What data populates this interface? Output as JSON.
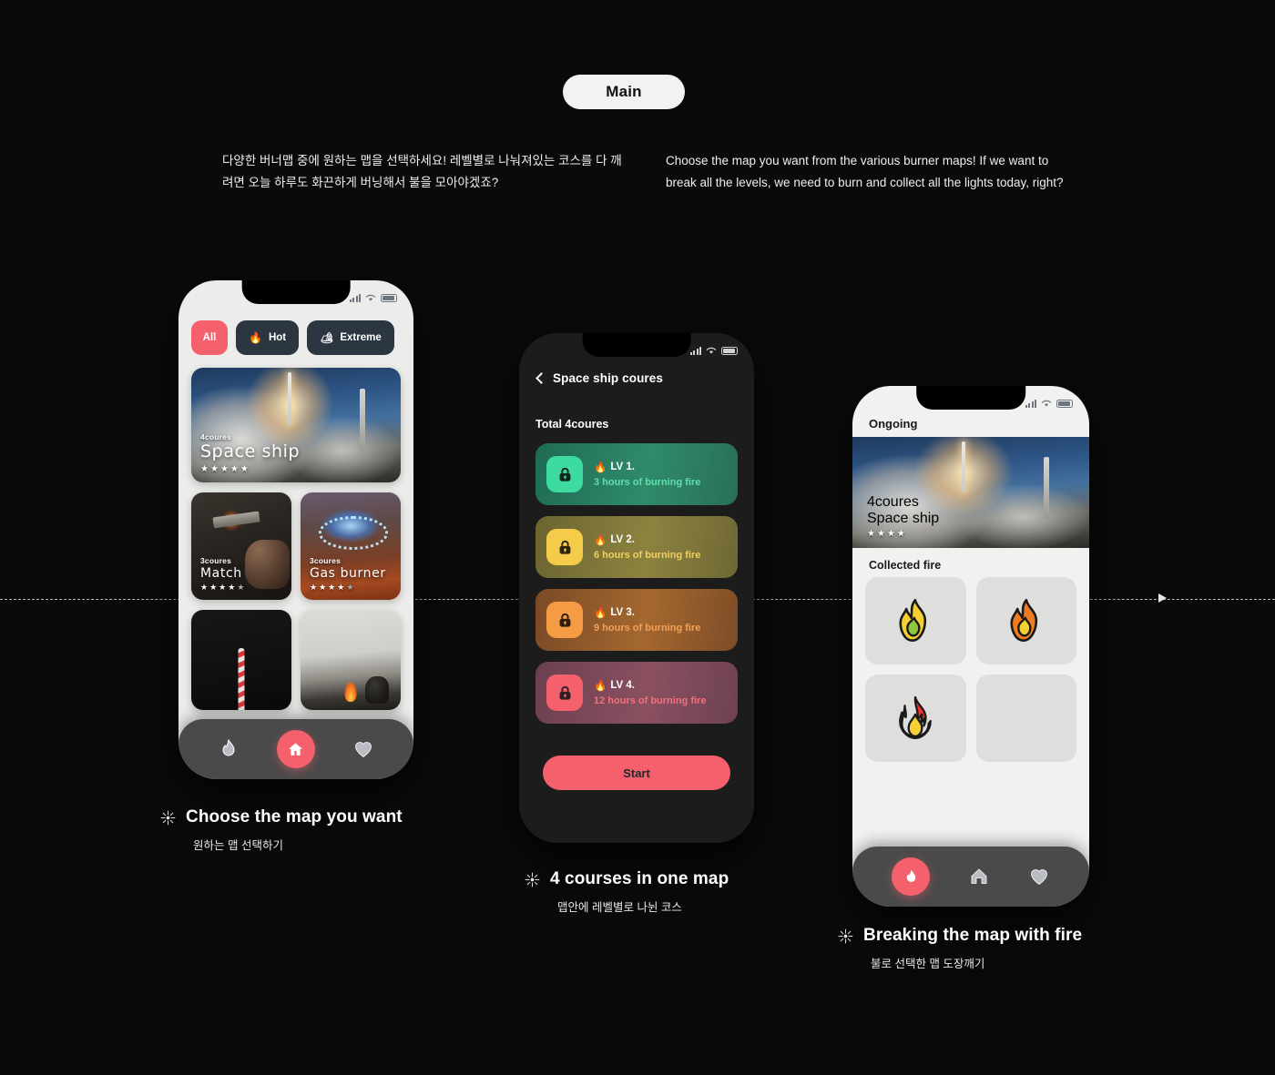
{
  "header": {
    "pill_label": "Main"
  },
  "description": {
    "korean": "다양한 버너맵 중에 원하는 맵을 선택하세요! 레벨별로 나눠져있는 코스를 다 깨려면 오늘 하루도 화끈하게 버닝해서 불을 모아야겠죠?",
    "english": "Choose the map you want from the various burner maps! If we want to break all the levels, we need to burn and collect all the lights today, right?"
  },
  "phone1": {
    "filters": [
      {
        "label": "All",
        "emoji": "",
        "active": true
      },
      {
        "label": "Hot",
        "emoji": "🔥",
        "active": false
      },
      {
        "label": "Extreme",
        "emoji": "🏕",
        "active": false
      }
    ],
    "cards": [
      {
        "coures": "4coures",
        "title": "Space ship",
        "stars": 5,
        "stars_total": 5
      },
      {
        "coures": "3coures",
        "title": "Match",
        "stars": 4,
        "stars_total": 5
      },
      {
        "coures": "3coures",
        "title": "Gas burner",
        "stars": 4,
        "stars_total": 5
      }
    ],
    "tabbar": [
      {
        "icon": "flame-icon",
        "active": false
      },
      {
        "icon": "home-icon",
        "active": true
      },
      {
        "icon": "heart-icon",
        "active": false
      }
    ]
  },
  "phone2": {
    "nav_title": "Space ship coures",
    "total_label": "Total 4coures",
    "levels": [
      {
        "name": "LV 1.",
        "desc": "3 hours of burning fire",
        "lock_color": "#3ddba0",
        "card_from": "#1f6b54",
        "card_to": "#2f8a6a",
        "text_color": "#5fe0ae"
      },
      {
        "name": "LV 2.",
        "desc": "6 hours of burning fire",
        "lock_color": "#f5cc4a",
        "card_from": "#6b6430",
        "card_to": "#8c8340",
        "text_color": "#f3cf5e"
      },
      {
        "name": "LV 3.",
        "desc": "9 hours of burning fire",
        "lock_color": "#f59b44",
        "card_from": "#7a4a26",
        "card_to": "#a4682f",
        "text_color": "#f5a055"
      },
      {
        "name": "LV 4.",
        "desc": "12 hours of burning fire",
        "lock_color": "#f4606c",
        "card_from": "#6b4050",
        "card_to": "#8a5060",
        "text_color": "#f4707c"
      }
    ],
    "start_label": "Start"
  },
  "phone3": {
    "header": "Ongoing",
    "hero": {
      "coures": "4coures",
      "title": "Space ship",
      "stars": 4,
      "stars_total": 4
    },
    "collected_label": "Collected fire",
    "fire_slots": [
      {
        "filled": true,
        "name": "flame-yellow-green-icon",
        "outer": "#f5d033",
        "inner": "#8fc63d"
      },
      {
        "filled": true,
        "name": "flame-orange-icon",
        "outer": "#f07c22",
        "inner": "#f5d033"
      },
      {
        "filled": true,
        "name": "flame-red-big-icon",
        "outer": "#ed3124",
        "inner": "#f5d033"
      },
      {
        "filled": false,
        "name": "flame-empty-slot",
        "outer": "",
        "inner": ""
      }
    ],
    "tabbar": [
      {
        "icon": "flame-icon",
        "active": true
      },
      {
        "icon": "home-icon",
        "active": false
      },
      {
        "icon": "heart-icon",
        "active": false
      }
    ]
  },
  "captions": [
    {
      "title": "Choose the map you want",
      "sub": "원하는 맵 선택하기"
    },
    {
      "title": "4 courses in one map",
      "sub": "맵안에 레벨별로 나뉜 코스"
    },
    {
      "title": "Breaking the map with fire",
      "sub": "불로 선택한 맵 도장깨기"
    }
  ],
  "colors": {
    "accent": "#f4606c",
    "background": "#0a0a0a",
    "tabbar": "#4a4a4a"
  }
}
